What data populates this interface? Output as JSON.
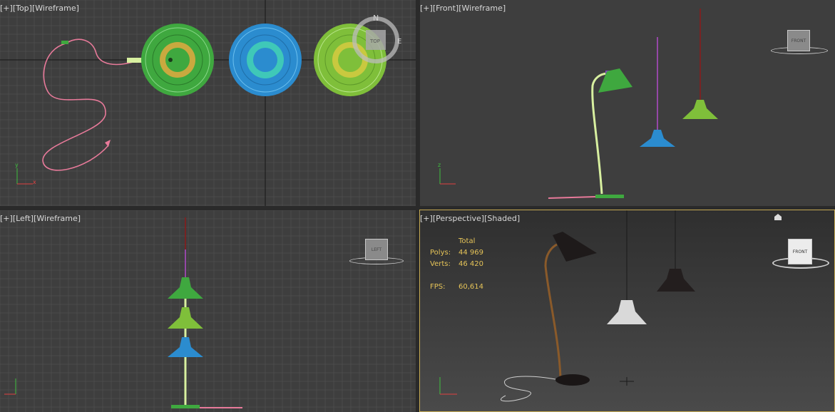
{
  "viewports": {
    "top": {
      "plus": "[+]",
      "view": "[Top]",
      "mode": "[Wireframe]"
    },
    "front": {
      "plus": "[+]",
      "view": "[Front]",
      "mode": "[Wireframe]"
    },
    "left": {
      "plus": "[+]",
      "view": "[Left]",
      "mode": "[Wireframe]"
    },
    "perspective": {
      "plus": "[+]",
      "view": "[Perspective]",
      "mode": "[Shaded]"
    }
  },
  "compass": {
    "n": "N",
    "e": "E",
    "center": "TOP"
  },
  "viewcube": {
    "front": "FRONT",
    "left": "LEFT",
    "persp": "FRONT"
  },
  "stats": {
    "header": "Total",
    "polys_label": "Polys:",
    "polys_value": "44 969",
    "verts_label": "Verts:",
    "verts_value": "46 420",
    "fps_label": "FPS:",
    "fps_value": "60,614"
  },
  "axis": {
    "x": "x",
    "y": "y",
    "z": "z"
  },
  "colors": {
    "viewport_bg": "#3e3e3e",
    "grid": "#555555",
    "active_border": "#c7ab52",
    "stats_text": "#e6c458",
    "lamp_green": "#3fa83f",
    "lamp_blue": "#2b8ccf",
    "lamp_lightgreen": "#7fbf3a",
    "cord_pink": "#e87a9a"
  }
}
